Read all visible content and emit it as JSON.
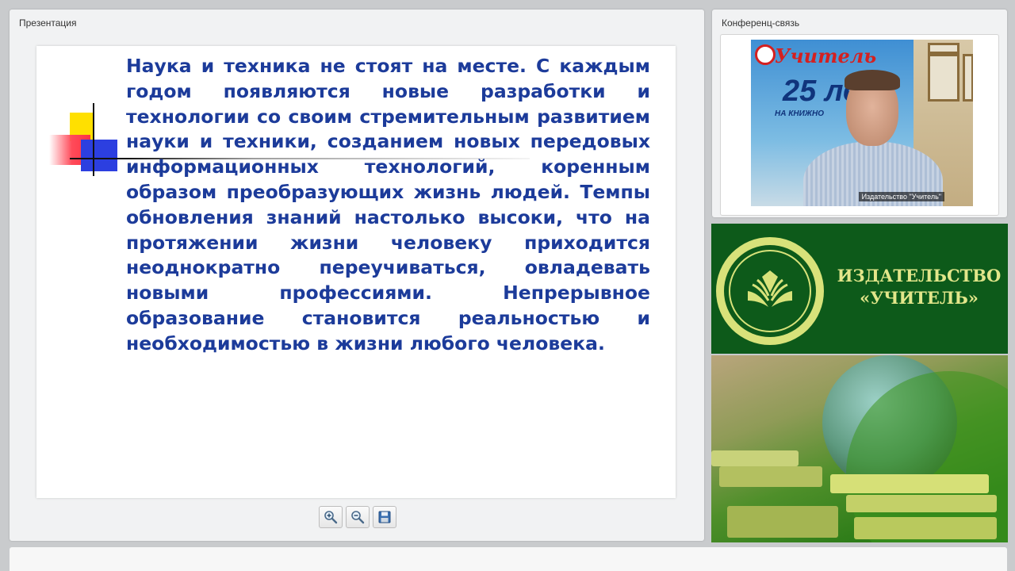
{
  "presentation": {
    "title": "Презентация",
    "slide_text": "Наука и техника не стоят на месте. С каждым годом появляются новые разработки и технологии со своим стремительным развитием науки и техники, созданием новых передовых информационных технологий, коренным образом преобразующих жизнь людей. Темпы обновления знаний настолько высоки, что на протяжении жизни человеку приходится неоднократно переучиваться, овладевать новыми профессиями. Непрерывное образование становится реальностью и необходимостью в жизни любого человека.",
    "toolbar": {
      "icons": [
        "zoom-in-icon",
        "zoom-out-icon",
        "save-icon"
      ]
    }
  },
  "conference": {
    "title": "Конференц-связь",
    "video_caption": "Издательство \"Учитель\"",
    "poster_title": "Учитель",
    "poster_number": "25 ле",
    "poster_sub": "НА КНИЖНО"
  },
  "brand": {
    "name_line1": "ИЗДАТЕЛЬСТВО",
    "name_line2": "«УЧИТЕЛЬ»",
    "colors": {
      "dark_green": "#0d5a1a",
      "logo_yellow": "#d8e27a"
    }
  },
  "colors": {
    "slide_text": "#1c3b9a",
    "background": "#c9cbcd"
  }
}
